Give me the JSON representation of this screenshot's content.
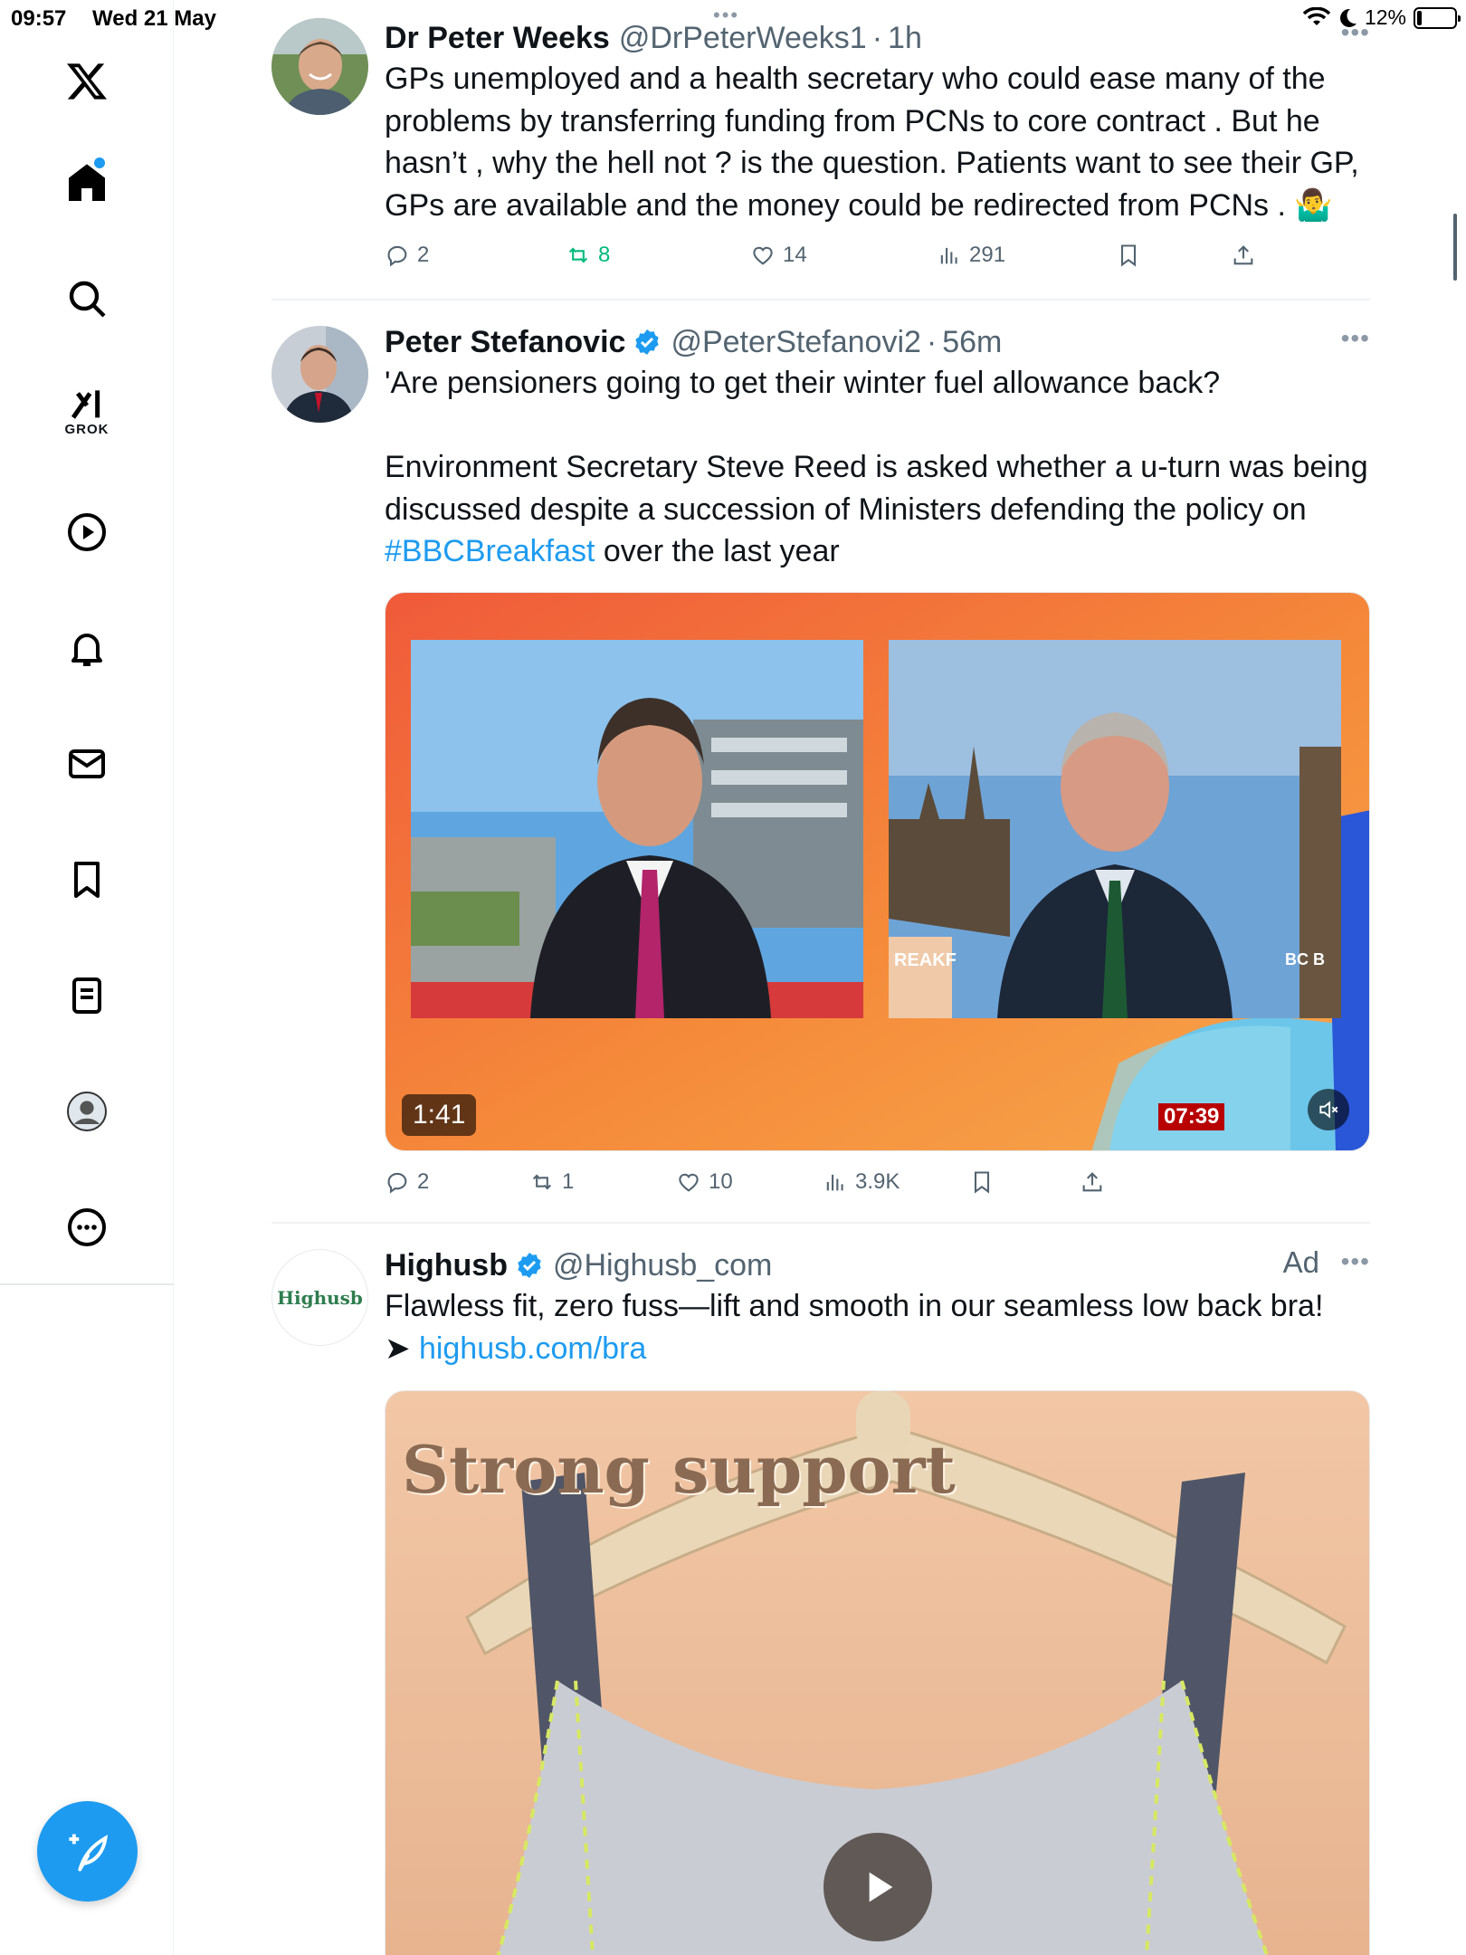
{
  "status_bar": {
    "time": "09:57",
    "date": "Wed 21 May",
    "battery": "12%",
    "battery_level": 0.12
  },
  "sidebar": {
    "items": [
      {
        "name": "x-logo",
        "label": ""
      },
      {
        "name": "home",
        "label": ""
      },
      {
        "name": "explore",
        "label": ""
      },
      {
        "name": "grok",
        "label": "GROK"
      },
      {
        "name": "videos",
        "label": ""
      },
      {
        "name": "notifications",
        "label": ""
      },
      {
        "name": "messages",
        "label": ""
      },
      {
        "name": "bookmarks",
        "label": ""
      },
      {
        "name": "lists",
        "label": ""
      },
      {
        "name": "profile",
        "label": ""
      },
      {
        "name": "more",
        "label": ""
      }
    ]
  },
  "feed": {
    "tweets": [
      {
        "name": "Dr Peter Weeks",
        "handle": "@DrPeterWeeks1",
        "time": "1h",
        "lines": [
          "GPs unemployed and a health secretary who could ease many of the",
          "problems by transferring funding from PCNs to core contract . But he",
          "hasn’t , why the hell not ? is the question. Patients want to see their GP,",
          "GPs are available and the money could be redirected from PCNs . 🤷‍♂️"
        ],
        "stats": {
          "replies": "2",
          "reposts": "8",
          "likes": "14",
          "views": "291"
        }
      },
      {
        "name": "Peter Stefanovic",
        "handle": "@PeterStefanovi2",
        "time": "56m",
        "lines": [
          "'Are pensioners going to get their winter fuel allowance back?",
          "",
          "Environment Secretary Steve Reed is asked whether a u-turn was being",
          "discussed despite a succession of Ministers defending the policy on"
        ],
        "hashtag": "#BBCBreakfast",
        "last_line_rest": " over the last year",
        "video": {
          "duration": "1:41",
          "clock": "07:39",
          "left_caption": "",
          "right_caption": "REAKF",
          "right_logo": "BC B"
        },
        "stats": {
          "replies": "2",
          "reposts": "1",
          "likes": "10",
          "views": "3.9K"
        }
      },
      {
        "name": "Highusb",
        "handle": "@Highusb_com",
        "avatar_text": "Highusb",
        "ad_label": "Ad",
        "line1": "Flawless fit, zero fuss—lift and smooth in our seamless low back bra!",
        "arrow": "➤ ",
        "link": "highusb.com/bra",
        "image_caption": "Strong support"
      }
    ]
  },
  "colors": {
    "accent": "#1d9bf0",
    "repost_green": "#00ba7c",
    "muted": "#536471"
  }
}
